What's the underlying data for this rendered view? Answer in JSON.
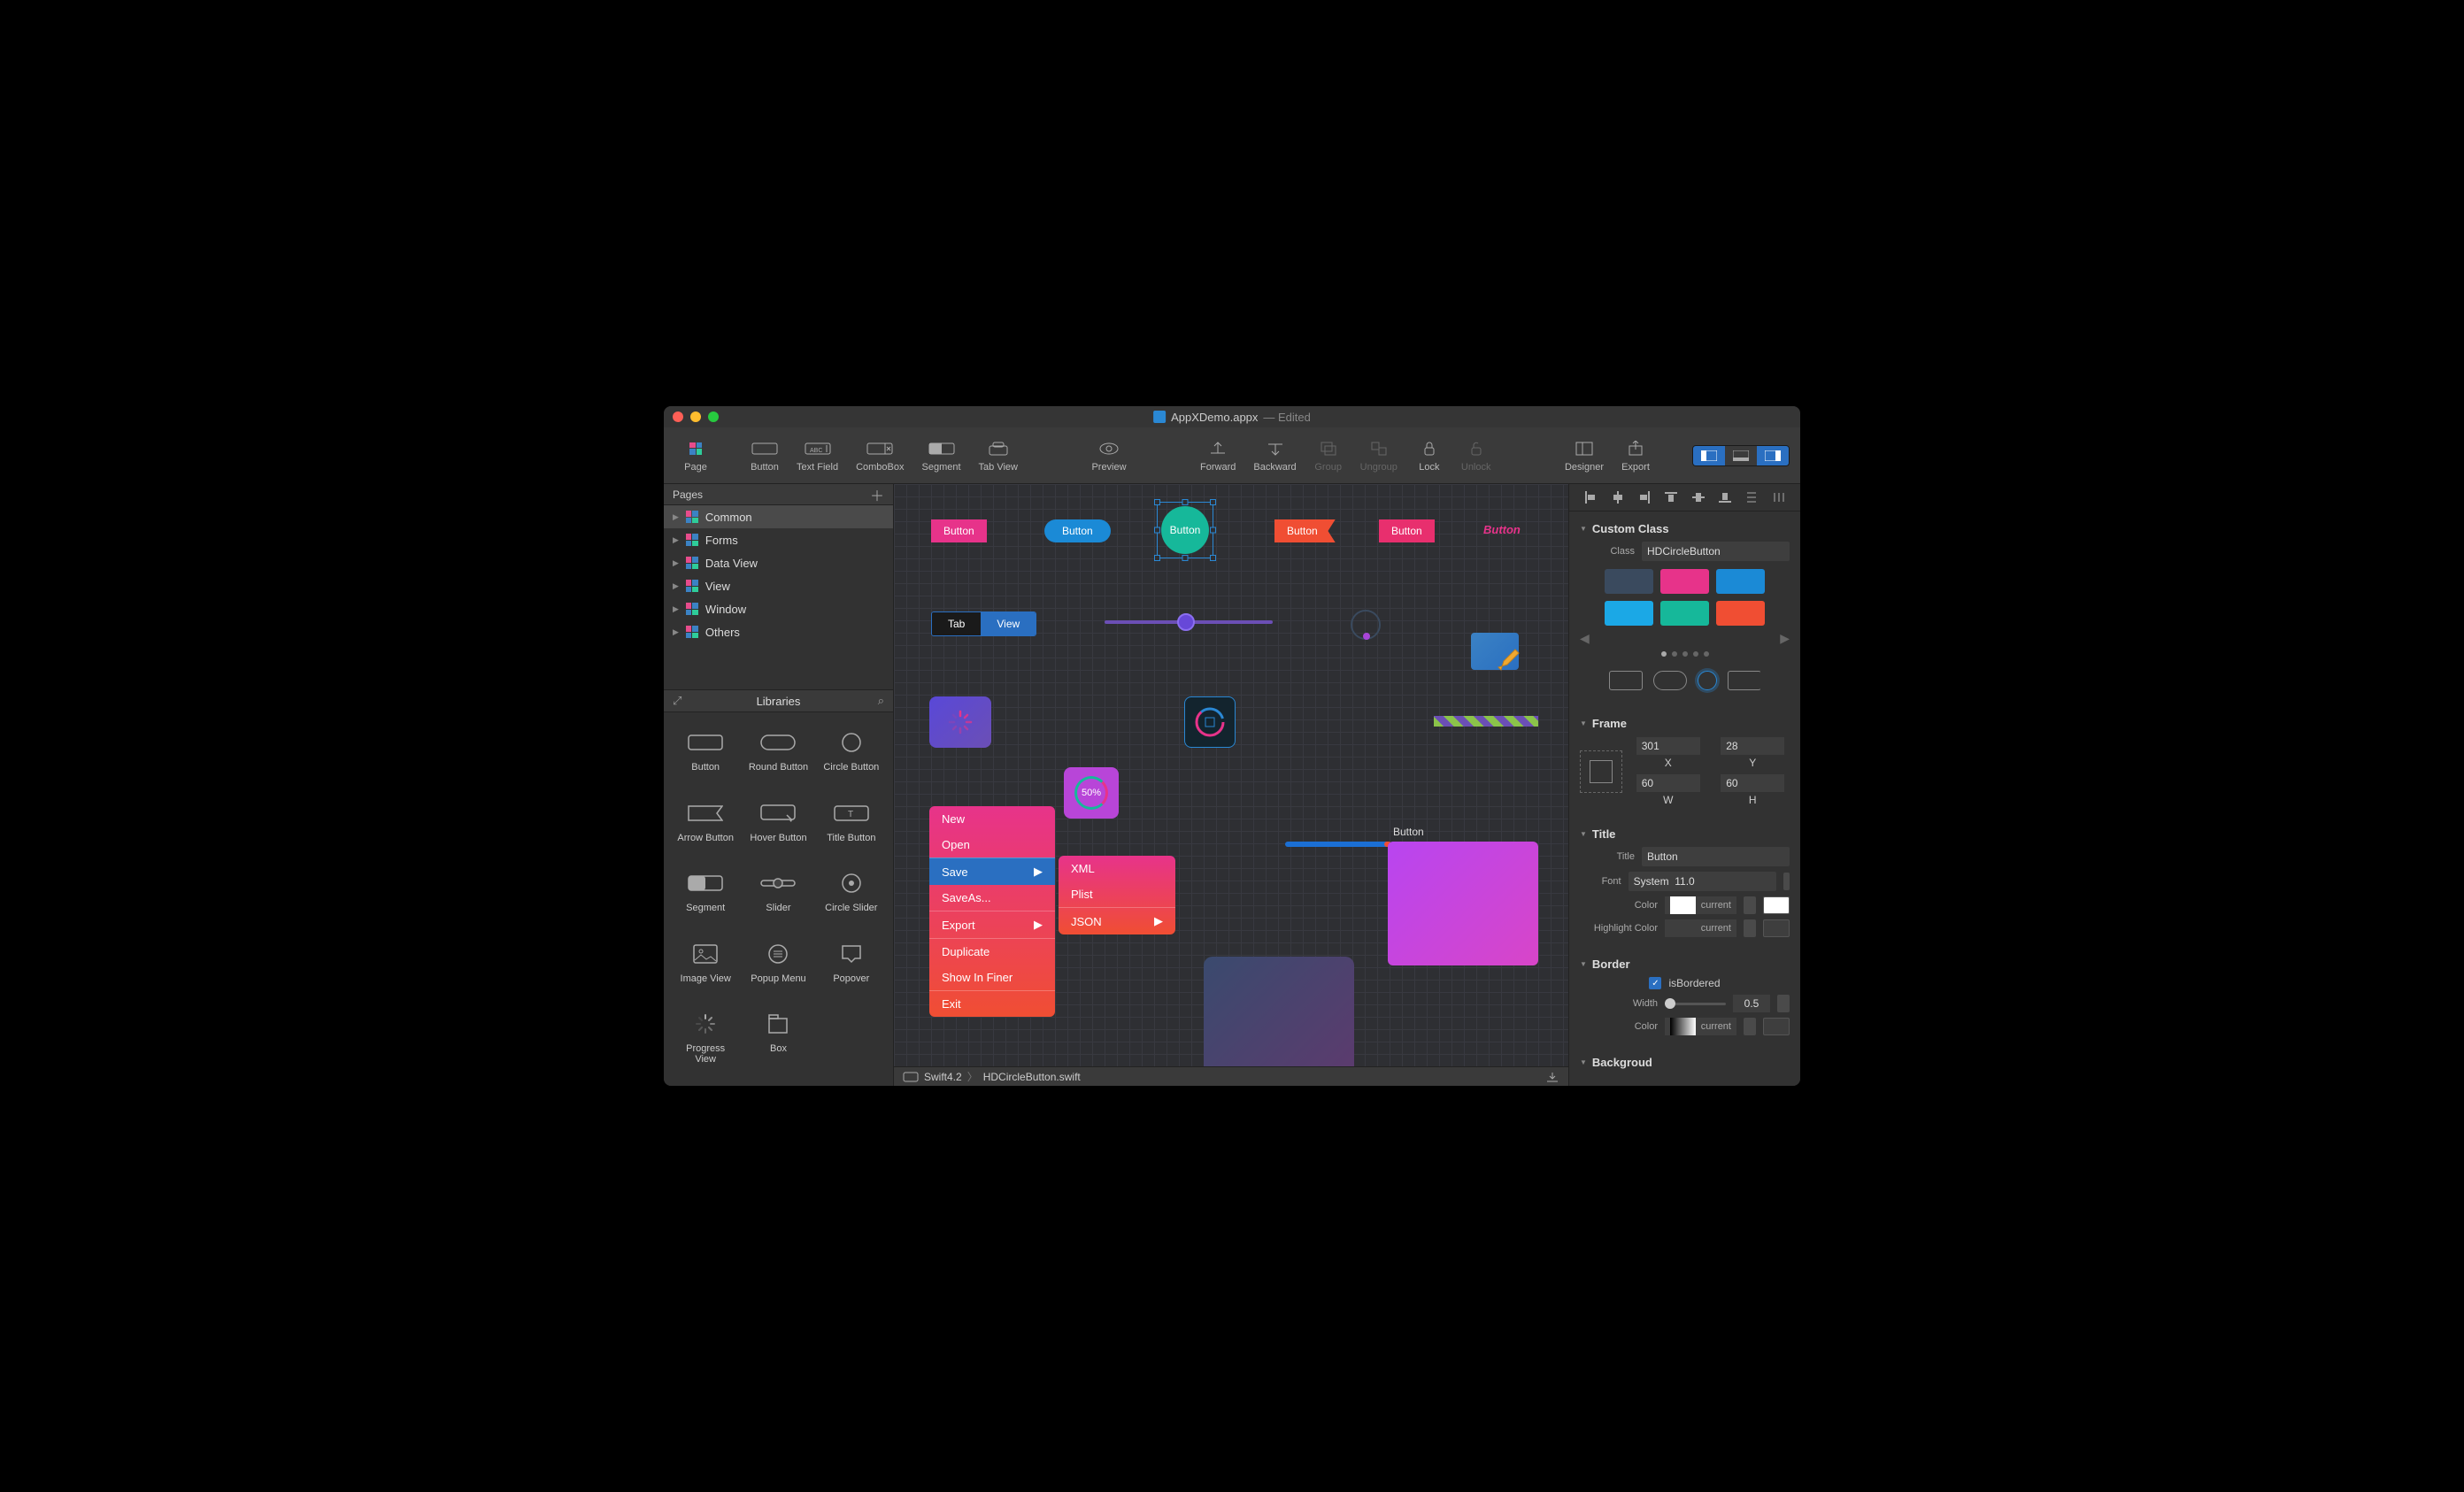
{
  "title": {
    "filename": "AppXDemo.appx",
    "status": "— Edited"
  },
  "toolbar": {
    "page": "Page",
    "button": "Button",
    "textfield": "Text Field",
    "combobox": "ComboBox",
    "segment": "Segment",
    "tabview": "Tab View",
    "preview": "Preview",
    "forward": "Forward",
    "backward": "Backward",
    "group": "Group",
    "ungroup": "Ungroup",
    "lock": "Lock",
    "unlock": "Unlock",
    "designer": "Designer",
    "export": "Export"
  },
  "pages": {
    "header": "Pages",
    "items": [
      "Common",
      "Forms",
      "Data View",
      "View",
      "Window",
      "Others"
    ]
  },
  "libraries": {
    "header": "Libraries",
    "items": [
      "Button",
      "Round Button",
      "Circle Button",
      "Arrow Button",
      "Hover Button",
      "Title Button",
      "Segment",
      "Slider",
      "Circle Slider",
      "Image View",
      "Popup Menu",
      "Popover",
      "Progress View",
      "Box"
    ]
  },
  "canvas": {
    "btn_label": "Button",
    "seg1": "Tab",
    "seg2": "View",
    "prog_pct": "50%",
    "menu": {
      "new": "New",
      "open": "Open",
      "save": "Save",
      "saveas": "SaveAs...",
      "export": "Export",
      "duplicate": "Duplicate",
      "showinfiner": "Show In Finer",
      "exit": "Exit"
    },
    "submenu": {
      "xml": "XML",
      "plist": "Plist",
      "json": "JSON"
    },
    "box_label": "Button"
  },
  "breadcrumb": {
    "lang": "Swift4.2",
    "file": "HDCircleButton.swift"
  },
  "inspector": {
    "customclass": {
      "header": "Custom Class",
      "class_label": "Class",
      "class_value": "HDCircleButton"
    },
    "swatches": [
      "#3a4a5e",
      "#e7338a",
      "#1b8ad6",
      "#1ba8e6",
      "#16b89a",
      "#f04e33"
    ],
    "frame": {
      "header": "Frame",
      "x": "301",
      "y": "28",
      "w": "60",
      "h": "60",
      "xl": "X",
      "yl": "Y",
      "wl": "W",
      "hl": "H"
    },
    "title": {
      "header": "Title",
      "title_label": "Title",
      "title_value": "Button",
      "font_label": "Font",
      "font_value": "System  11.0",
      "color_label": "Color",
      "hcolor_label": "Highlight Color",
      "current": "current"
    },
    "border": {
      "header": "Border",
      "bordered": "isBordered",
      "width_label": "Width",
      "width_value": "0.5",
      "color_label": "Color"
    },
    "background": {
      "header": "Backgroud"
    }
  }
}
